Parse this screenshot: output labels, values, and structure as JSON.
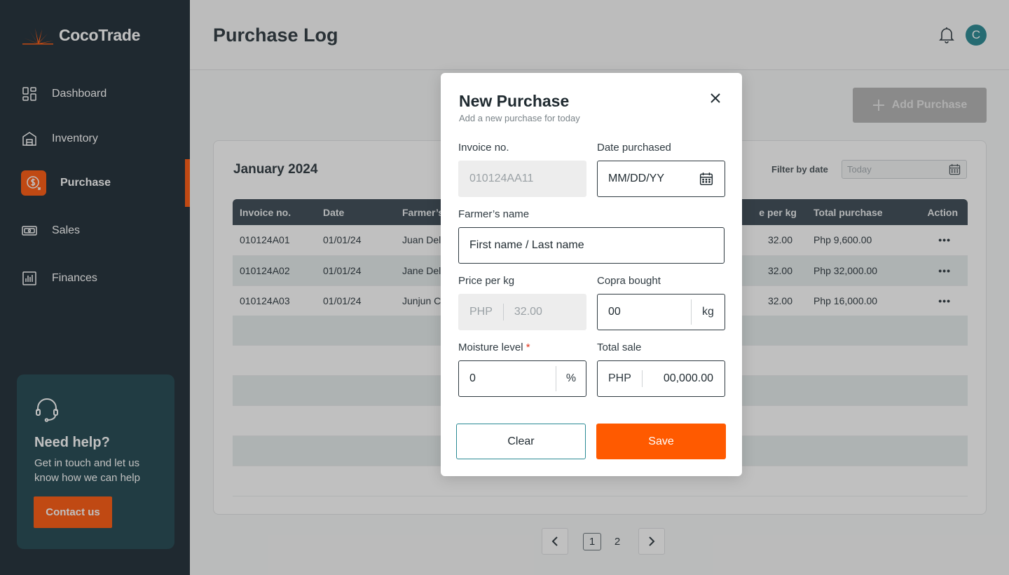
{
  "brand": {
    "name": "CocoTrade",
    "accent": "#ff5a10",
    "sidebar_bg": "#212f38"
  },
  "sidebar": {
    "items": [
      {
        "label": "Dashboard",
        "icon": "dashboard-icon"
      },
      {
        "label": "Inventory",
        "icon": "warehouse-icon"
      },
      {
        "label": "Purchase",
        "icon": "coin-icon",
        "active": true
      },
      {
        "label": "Sales",
        "icon": "cash-icon"
      },
      {
        "label": "Finances",
        "icon": "bar-chart-icon"
      }
    ],
    "help": {
      "title": "Need help?",
      "text": "Get in touch and let us know how we can help",
      "button": "Contact us"
    }
  },
  "header": {
    "title": "Purchase Log",
    "avatar_initial": "C"
  },
  "toolbar": {
    "add_label": "Add Purchase"
  },
  "log": {
    "month": "January 2024",
    "filter_label": "Filter by date",
    "filter_placeholder": "Today",
    "columns": [
      "Invoice no.",
      "Date",
      "Farmer’s",
      "e per kg",
      "Total purchase",
      "Action"
    ],
    "rows": [
      {
        "invoice": "010124A01",
        "date": "01/01/24",
        "farmer": "Juan Del",
        "price": "32.00",
        "total": "Php 9,600.00",
        "action": "•••"
      },
      {
        "invoice": "010124A02",
        "date": "01/01/24",
        "farmer": "Jane Del",
        "price": "32.00",
        "total": "Php 32,000.00",
        "action": "•••"
      },
      {
        "invoice": "010124A03",
        "date": "01/01/24",
        "farmer": "Junjun C",
        "price": "32.00",
        "total": "Php 16,000.00",
        "action": "•••"
      }
    ]
  },
  "pagination": {
    "pages": [
      "1",
      "2"
    ],
    "current": "1"
  },
  "modal": {
    "title": "New Purchase",
    "subtitle": "Add a new purchase for today",
    "fields": {
      "invoice": {
        "label": "Invoice no.",
        "value": "010124AA11"
      },
      "date": {
        "label": "Date purchased",
        "placeholder": "MM/DD/YY"
      },
      "farmer": {
        "label": "Farmer’s name",
        "placeholder": "First name / Last name"
      },
      "price": {
        "label": "Price per kg",
        "prefix": "PHP",
        "value": "32.00"
      },
      "copra": {
        "label": "Copra bought",
        "value": "00",
        "suffix": "kg"
      },
      "moisture": {
        "label": "Moisture level",
        "required": "*",
        "value": "0",
        "suffix": "%"
      },
      "total": {
        "label": "Total sale",
        "prefix": "PHP",
        "value": "00,000.00"
      }
    },
    "clear_label": "Clear",
    "save_label": "Save"
  }
}
